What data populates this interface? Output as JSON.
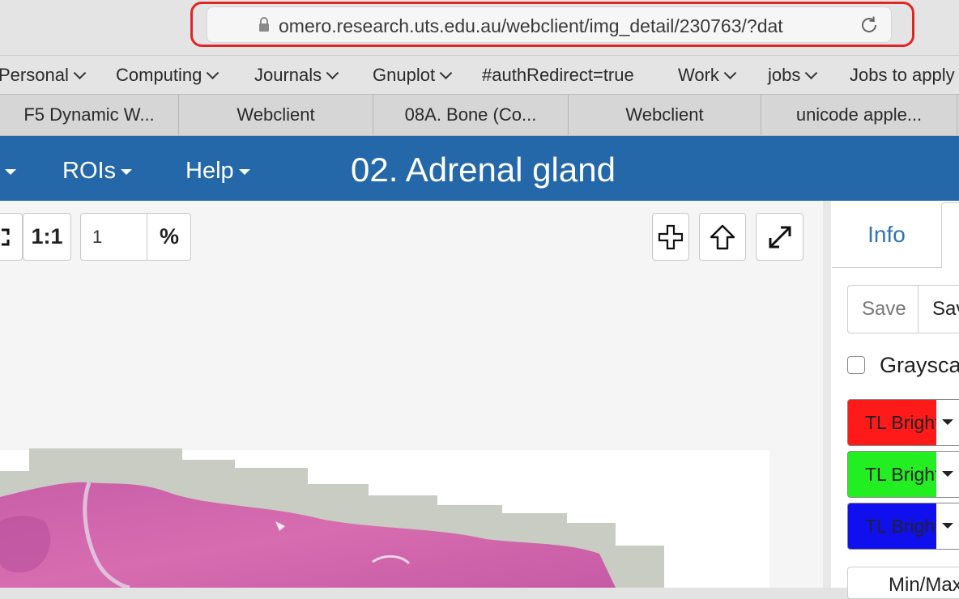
{
  "browser": {
    "url": "omero.research.uts.edu.au/webclient/img_detail/230763/?dat",
    "bookmarks": [
      {
        "label": "Personal",
        "dropdown": true
      },
      {
        "label": "Computing",
        "dropdown": true
      },
      {
        "label": "Journals",
        "dropdown": true
      },
      {
        "label": "Gnuplot",
        "dropdown": true
      },
      {
        "label": "#authRedirect=true",
        "dropdown": false
      },
      {
        "label": "Work",
        "dropdown": true
      },
      {
        "label": "jobs",
        "dropdown": true
      },
      {
        "label": "Jobs to apply",
        "dropdown": false
      }
    ],
    "tabs": [
      {
        "label": "F5 Dynamic W..."
      },
      {
        "label": "Webclient"
      },
      {
        "label": "08A. Bone (Co..."
      },
      {
        "label": "Webclient"
      },
      {
        "label": "unicode apple..."
      }
    ],
    "highlight_color": "#e02525"
  },
  "app": {
    "header_color": "#2468a9",
    "menus": {
      "rois": "ROIs",
      "help": "Help"
    },
    "title": "02. Adrenal gland"
  },
  "viewer": {
    "toolbar": {
      "one_to_one": "1:1",
      "zoom_value": "1",
      "zoom_unit": "%"
    }
  },
  "panel": {
    "tabs": {
      "info": "Info"
    },
    "save_buttons": [
      "Save",
      "Save"
    ],
    "grayscale_label": "Grayscale",
    "grayscale_checked": false,
    "channels": [
      {
        "label": "TL Brightfield",
        "color": "#ff1a1a"
      },
      {
        "label": "TL Brightfield",
        "color": "#22ee22"
      },
      {
        "label": "TL Brightfield",
        "color": "#1010ee"
      }
    ],
    "bottom_button": "Min/Max"
  }
}
